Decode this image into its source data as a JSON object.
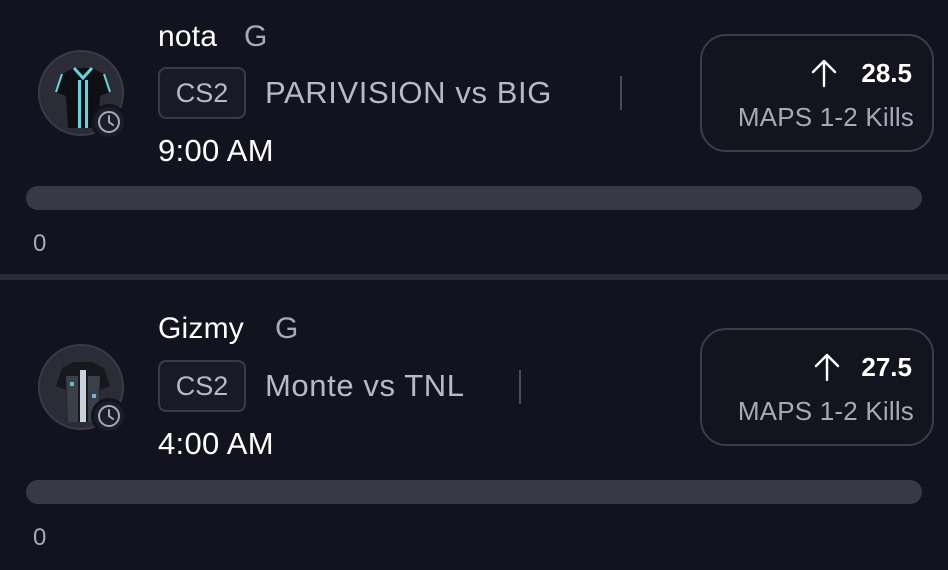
{
  "picks": [
    {
      "player": "nota",
      "position": "G",
      "game": "CS2",
      "matchup": "PARIVISION vs BIG",
      "time": "9:00 AM",
      "line": "28.5",
      "direction_icon": "arrow-up-icon",
      "stat": "MAPS 1-2 Kills",
      "progress_value": 0,
      "progress_fraction": 0,
      "jersey_colors": {
        "body": "#0d0f12",
        "accent": "#5fd6e0"
      }
    },
    {
      "player": "Gizmy",
      "position": "G",
      "game": "CS2",
      "matchup": "Monte vs TNL",
      "time": "4:00 AM",
      "line": "27.5",
      "direction_icon": "arrow-up-icon",
      "stat": "MAPS 1-2 Kills",
      "progress_value": 0,
      "progress_fraction": 0,
      "jersey_colors": {
        "body": "#15181c",
        "accent": "#c9d2d8"
      }
    }
  ],
  "colors": {
    "background": "#13131f",
    "divider": "#2b2b38",
    "track": "#393946",
    "muted_text": "#a9a9b6"
  }
}
